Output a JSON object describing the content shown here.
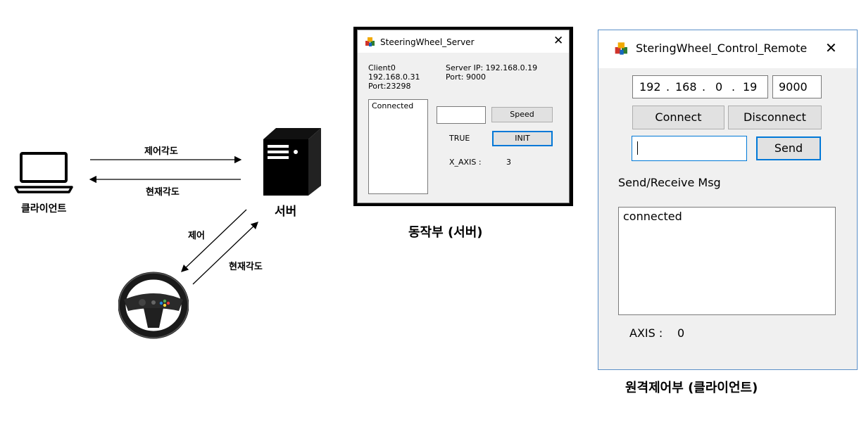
{
  "diagram": {
    "client_label": "클라이언트",
    "server_label": "서버",
    "arrow_top_label": "제어각도",
    "arrow_bottom_label": "현재각도",
    "diag_control_label": "제어",
    "diag_current_label": "현재각도"
  },
  "server_window": {
    "title": "SteeringWheel_Server",
    "client_name": "Client0",
    "client_ip": "192.168.0.31",
    "client_port": "Port:23298",
    "server_ip": "Server IP: 192.168.0.19",
    "server_port": "Port: 9000",
    "log_text": "Connected",
    "speed_input": "",
    "speed_button": "Speed",
    "state_text": "TRUE",
    "init_button": "INIT",
    "axis_label": "X_AXIS :",
    "axis_value": "3",
    "caption": "동작부 (서버)"
  },
  "remote_window": {
    "title": "SteringWheel_Control_Remote",
    "ip_parts": [
      "192",
      "168",
      "0",
      "19"
    ],
    "port": "9000",
    "connect_button": "Connect",
    "disconnect_button": "Disconnect",
    "message_input": "",
    "send_button": "Send",
    "msg_label": "Send/Receive Msg",
    "msg_log": "connected",
    "axis_label": "AXIS :",
    "axis_value": "0",
    "caption": "원격제어부 (클라이언트)"
  },
  "colors": {
    "remote_border": "#5a8fc8",
    "focus_border": "#0078d7",
    "window_bg": "#f0f0f0"
  }
}
